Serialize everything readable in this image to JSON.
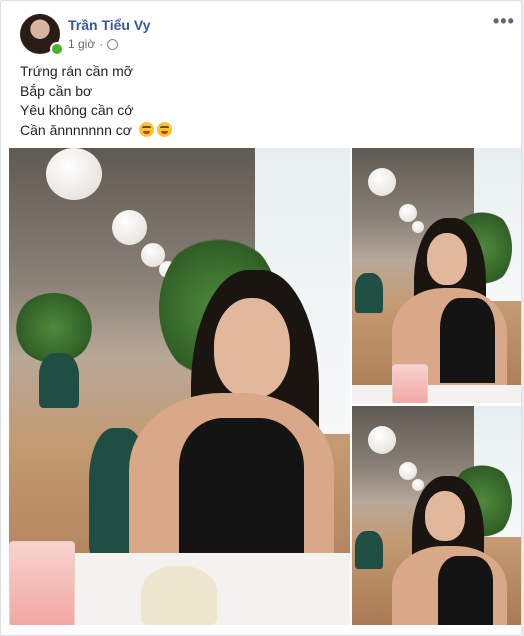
{
  "post": {
    "author": "Trần Tiểu Vy",
    "time": "1 giờ",
    "privacy_icon": "globe-icon",
    "more_icon": "more-options-icon",
    "more_label": "•••",
    "caption_lines": [
      "Trứng rán cần mỡ",
      "Bắp cần bơ",
      "Yêu không cần cớ",
      "Cần ănnnnnnn cơ"
    ],
    "emojis": [
      "squinting-tongue-emoji",
      "squinting-tongue-emoji"
    ],
    "photos": [
      "photo-1",
      "photo-2",
      "photo-3"
    ]
  },
  "colors": {
    "author": "#385898",
    "online": "#42b72a",
    "text": "#1d2129",
    "meta": "#616770"
  }
}
